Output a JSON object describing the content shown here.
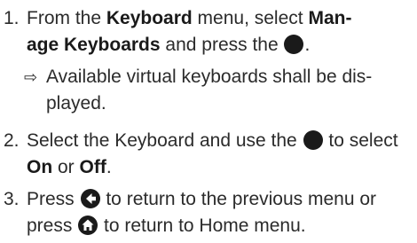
{
  "steps": [
    {
      "number": "1.",
      "part1": "From the ",
      "bold1": "Keyboard",
      "part2": " menu, select ",
      "bold2": "Man-age Keyboards",
      "part3": " and press the ",
      "part4": "."
    },
    {
      "number": "2.",
      "part1": "Select the Keyboard and use the ",
      "part2": " to select ",
      "bold1": "On",
      "part3": " or ",
      "bold2": "Off",
      "part4": "."
    },
    {
      "number": "3.",
      "part1": "Press ",
      "part2": " to return to the previous menu or press ",
      "part3": " to return to Home menu."
    }
  ],
  "result": {
    "arrow": "⇨",
    "text": "Available virtual keyboards shall be dis-played."
  },
  "icons": {
    "ok": "ok-button-icon",
    "back": "back-arrow-icon",
    "home": "home-icon"
  },
  "colors": {
    "text": "#2b2b2b",
    "icon": "#1a1a1a"
  }
}
